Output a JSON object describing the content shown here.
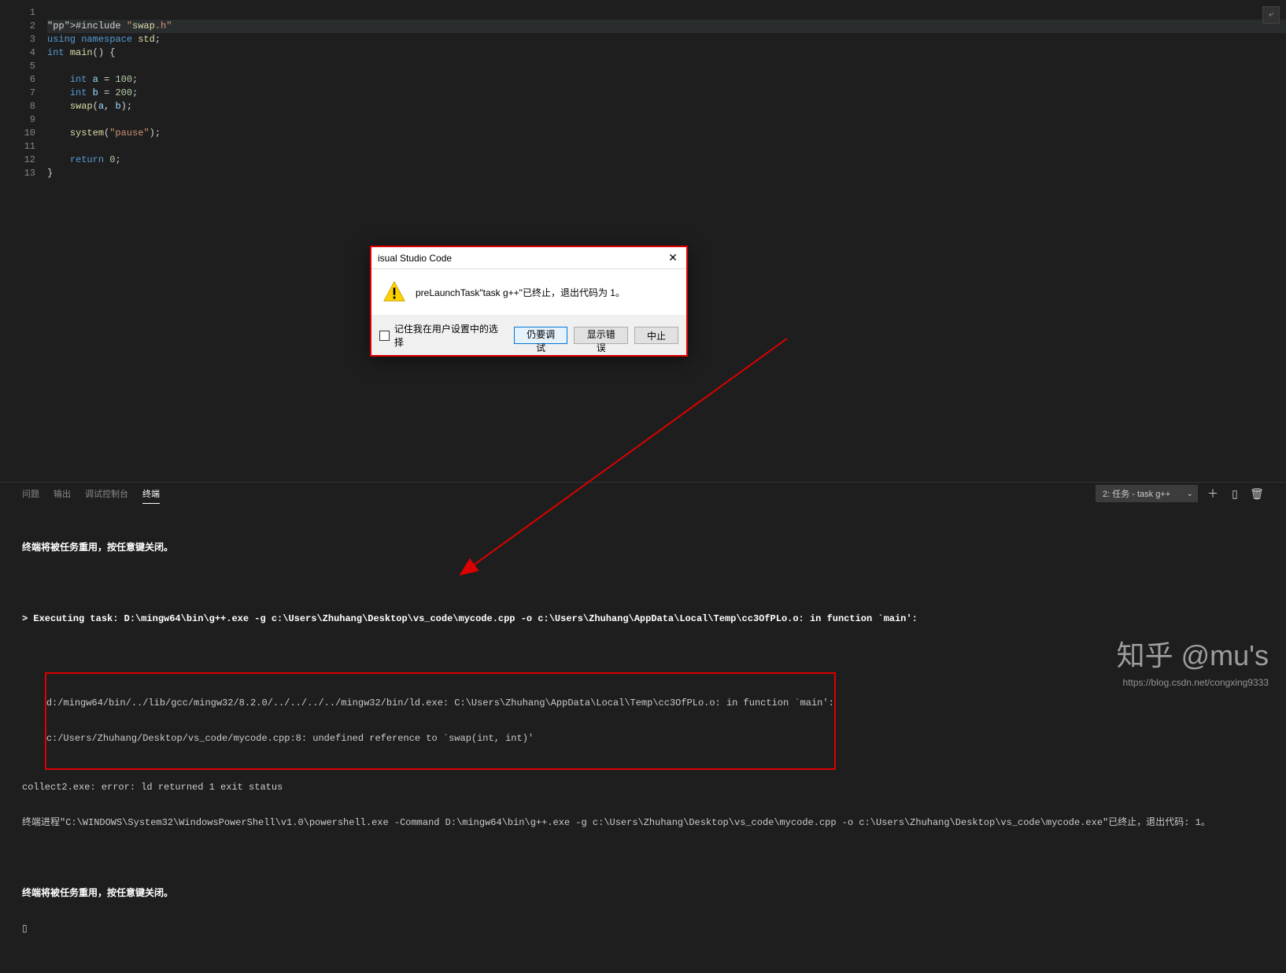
{
  "code": {
    "lines": [
      {
        "n": "1",
        "raw": ""
      },
      {
        "n": "2",
        "raw": "#include \"swap.h\"",
        "hl": true
      },
      {
        "n": "3",
        "raw": "using namespace std;"
      },
      {
        "n": "4",
        "raw": "int main() {"
      },
      {
        "n": "5",
        "raw": ""
      },
      {
        "n": "6",
        "raw": "    int a = 100;"
      },
      {
        "n": "7",
        "raw": "    int b = 200;"
      },
      {
        "n": "8",
        "raw": "    swap(a, b);"
      },
      {
        "n": "9",
        "raw": ""
      },
      {
        "n": "10",
        "raw": "    system(\"pause\");"
      },
      {
        "n": "11",
        "raw": ""
      },
      {
        "n": "12",
        "raw": "    return 0;"
      },
      {
        "n": "13",
        "raw": "}"
      }
    ]
  },
  "dialog": {
    "title": "isual Studio Code",
    "message": "preLaunchTask\"task g++\"已终止，退出代码为 1。",
    "check_label": "记住我在用户设置中的选择",
    "btn_debug": "仍要调试",
    "btn_show_error": "显示错误",
    "btn_abort": "中止"
  },
  "panel": {
    "tabs": {
      "problems": "问题",
      "output": "输出",
      "debug_console": "调试控制台",
      "terminal": "终端"
    },
    "task_selector": "2: 任务 - task g++"
  },
  "terminal": {
    "reuse_msg": "终端将被任务重用，按任意键关闭。",
    "exec_line": "> Executing task: D:\\mingw64\\bin\\g++.exe -g c:\\Users\\Zhuhang\\Desktop\\vs_code\\mycode.cpp -o c:\\Users\\Zhuhang\\AppData\\Local\\Temp\\cc3OfPLo.o: in function `main':",
    "err1": "d:/mingw64/bin/../lib/gcc/mingw32/8.2.0/../../../../mingw32/bin/ld.exe: C:\\Users\\Zhuhang\\AppData\\Local\\Temp\\cc3OfPLo.o: in function `main':",
    "err2": "c:/Users/Zhuhang/Desktop/vs_code/mycode.cpp:8: undefined reference to `swap(int, int)'",
    "err3": "collect2.exe: error: ld returned 1 exit status",
    "exit_line": "终端进程\"C:\\WINDOWS\\System32\\WindowsPowerShell\\v1.0\\powershell.exe -Command D:\\mingw64\\bin\\g++.exe -g c:\\Users\\Zhuhang\\Desktop\\vs_code\\mycode.cpp -o c:\\Users\\Zhuhang\\Desktop\\vs_code\\mycode.exe\"已终止，退出代码: 1。",
    "reuse_msg2": "终端将被任务重用，按任意键关闭。"
  },
  "watermark": {
    "brand": "知乎 @mu's",
    "url": "https://blog.csdn.net/congxing9333"
  }
}
